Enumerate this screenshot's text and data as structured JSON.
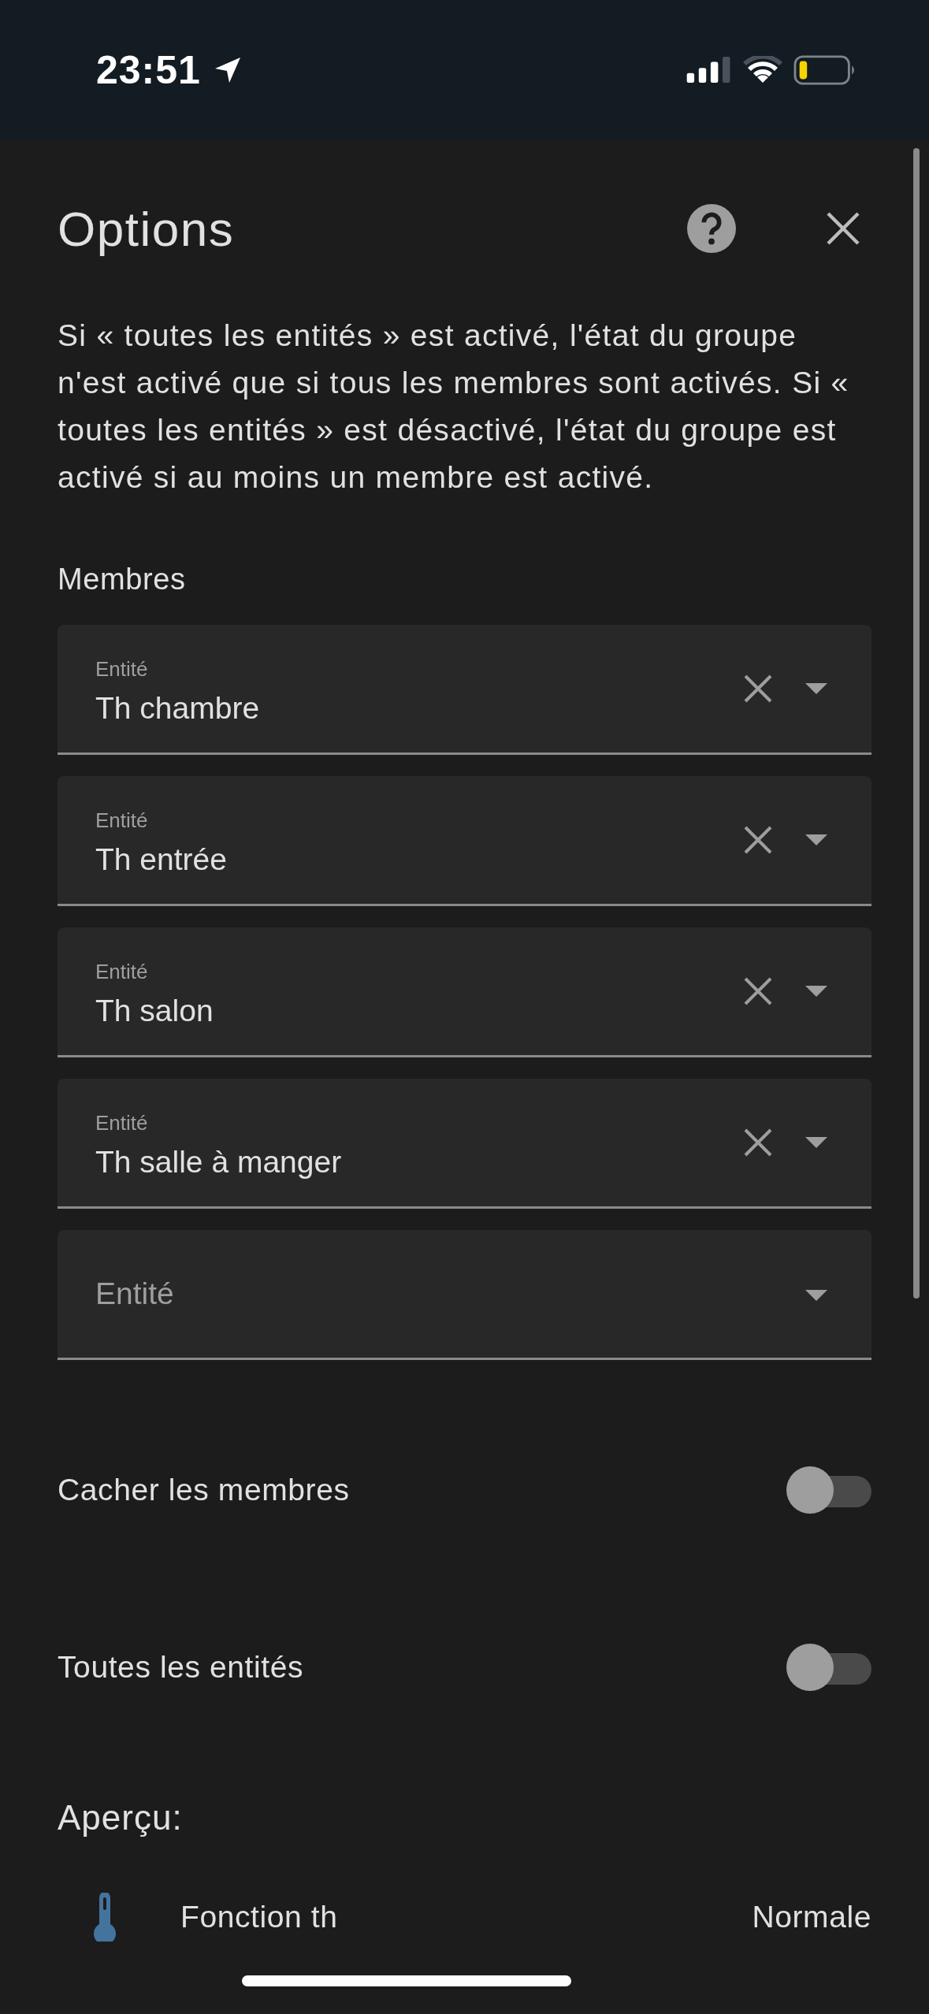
{
  "status_bar": {
    "time": "23:51"
  },
  "dialog": {
    "title": "Options",
    "description": "Si « toutes les entités » est activé, l'état du groupe n'est activé que si tous les membres sont activés. Si « toutes les entités » est désactivé, l'état du groupe est activé si au moins un membre est activé.",
    "members_label": "Membres",
    "members": [
      {
        "label": "Entité",
        "value": "Th chambre"
      },
      {
        "label": "Entité",
        "value": "Th entrée"
      },
      {
        "label": "Entité",
        "value": "Th salon"
      },
      {
        "label": "Entité",
        "value": "Th salle à manger"
      }
    ],
    "new_member": {
      "placeholder": "Entité"
    },
    "settings": [
      {
        "label": "Cacher les membres",
        "on": false
      },
      {
        "label": "Toutes les entités",
        "on": false
      }
    ],
    "preview": {
      "title": "Aperçu:",
      "name": "Fonction th",
      "state": "Normale"
    }
  }
}
